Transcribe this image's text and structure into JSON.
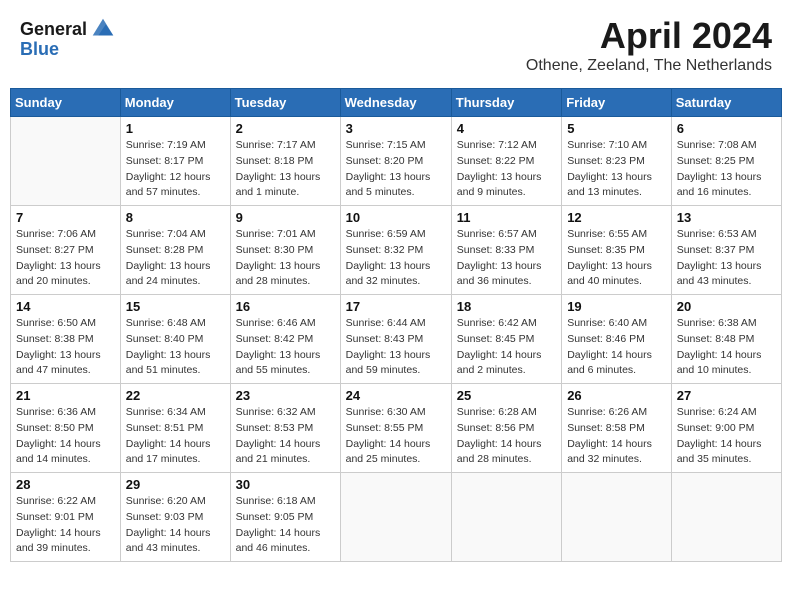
{
  "header": {
    "logo_general": "General",
    "logo_blue": "Blue",
    "month_title": "April 2024",
    "location": "Othene, Zeeland, The Netherlands"
  },
  "weekdays": [
    "Sunday",
    "Monday",
    "Tuesday",
    "Wednesday",
    "Thursday",
    "Friday",
    "Saturday"
  ],
  "weeks": [
    [
      {
        "day": "",
        "sunrise": "",
        "sunset": "",
        "daylight": "",
        "empty": true
      },
      {
        "day": "1",
        "sunrise": "Sunrise: 7:19 AM",
        "sunset": "Sunset: 8:17 PM",
        "daylight": "Daylight: 12 hours and 57 minutes."
      },
      {
        "day": "2",
        "sunrise": "Sunrise: 7:17 AM",
        "sunset": "Sunset: 8:18 PM",
        "daylight": "Daylight: 13 hours and 1 minute."
      },
      {
        "day": "3",
        "sunrise": "Sunrise: 7:15 AM",
        "sunset": "Sunset: 8:20 PM",
        "daylight": "Daylight: 13 hours and 5 minutes."
      },
      {
        "day": "4",
        "sunrise": "Sunrise: 7:12 AM",
        "sunset": "Sunset: 8:22 PM",
        "daylight": "Daylight: 13 hours and 9 minutes."
      },
      {
        "day": "5",
        "sunrise": "Sunrise: 7:10 AM",
        "sunset": "Sunset: 8:23 PM",
        "daylight": "Daylight: 13 hours and 13 minutes."
      },
      {
        "day": "6",
        "sunrise": "Sunrise: 7:08 AM",
        "sunset": "Sunset: 8:25 PM",
        "daylight": "Daylight: 13 hours and 16 minutes."
      }
    ],
    [
      {
        "day": "7",
        "sunrise": "Sunrise: 7:06 AM",
        "sunset": "Sunset: 8:27 PM",
        "daylight": "Daylight: 13 hours and 20 minutes."
      },
      {
        "day": "8",
        "sunrise": "Sunrise: 7:04 AM",
        "sunset": "Sunset: 8:28 PM",
        "daylight": "Daylight: 13 hours and 24 minutes."
      },
      {
        "day": "9",
        "sunrise": "Sunrise: 7:01 AM",
        "sunset": "Sunset: 8:30 PM",
        "daylight": "Daylight: 13 hours and 28 minutes."
      },
      {
        "day": "10",
        "sunrise": "Sunrise: 6:59 AM",
        "sunset": "Sunset: 8:32 PM",
        "daylight": "Daylight: 13 hours and 32 minutes."
      },
      {
        "day": "11",
        "sunrise": "Sunrise: 6:57 AM",
        "sunset": "Sunset: 8:33 PM",
        "daylight": "Daylight: 13 hours and 36 minutes."
      },
      {
        "day": "12",
        "sunrise": "Sunrise: 6:55 AM",
        "sunset": "Sunset: 8:35 PM",
        "daylight": "Daylight: 13 hours and 40 minutes."
      },
      {
        "day": "13",
        "sunrise": "Sunrise: 6:53 AM",
        "sunset": "Sunset: 8:37 PM",
        "daylight": "Daylight: 13 hours and 43 minutes."
      }
    ],
    [
      {
        "day": "14",
        "sunrise": "Sunrise: 6:50 AM",
        "sunset": "Sunset: 8:38 PM",
        "daylight": "Daylight: 13 hours and 47 minutes."
      },
      {
        "day": "15",
        "sunrise": "Sunrise: 6:48 AM",
        "sunset": "Sunset: 8:40 PM",
        "daylight": "Daylight: 13 hours and 51 minutes."
      },
      {
        "day": "16",
        "sunrise": "Sunrise: 6:46 AM",
        "sunset": "Sunset: 8:42 PM",
        "daylight": "Daylight: 13 hours and 55 minutes."
      },
      {
        "day": "17",
        "sunrise": "Sunrise: 6:44 AM",
        "sunset": "Sunset: 8:43 PM",
        "daylight": "Daylight: 13 hours and 59 minutes."
      },
      {
        "day": "18",
        "sunrise": "Sunrise: 6:42 AM",
        "sunset": "Sunset: 8:45 PM",
        "daylight": "Daylight: 14 hours and 2 minutes."
      },
      {
        "day": "19",
        "sunrise": "Sunrise: 6:40 AM",
        "sunset": "Sunset: 8:46 PM",
        "daylight": "Daylight: 14 hours and 6 minutes."
      },
      {
        "day": "20",
        "sunrise": "Sunrise: 6:38 AM",
        "sunset": "Sunset: 8:48 PM",
        "daylight": "Daylight: 14 hours and 10 minutes."
      }
    ],
    [
      {
        "day": "21",
        "sunrise": "Sunrise: 6:36 AM",
        "sunset": "Sunset: 8:50 PM",
        "daylight": "Daylight: 14 hours and 14 minutes."
      },
      {
        "day": "22",
        "sunrise": "Sunrise: 6:34 AM",
        "sunset": "Sunset: 8:51 PM",
        "daylight": "Daylight: 14 hours and 17 minutes."
      },
      {
        "day": "23",
        "sunrise": "Sunrise: 6:32 AM",
        "sunset": "Sunset: 8:53 PM",
        "daylight": "Daylight: 14 hours and 21 minutes."
      },
      {
        "day": "24",
        "sunrise": "Sunrise: 6:30 AM",
        "sunset": "Sunset: 8:55 PM",
        "daylight": "Daylight: 14 hours and 25 minutes."
      },
      {
        "day": "25",
        "sunrise": "Sunrise: 6:28 AM",
        "sunset": "Sunset: 8:56 PM",
        "daylight": "Daylight: 14 hours and 28 minutes."
      },
      {
        "day": "26",
        "sunrise": "Sunrise: 6:26 AM",
        "sunset": "Sunset: 8:58 PM",
        "daylight": "Daylight: 14 hours and 32 minutes."
      },
      {
        "day": "27",
        "sunrise": "Sunrise: 6:24 AM",
        "sunset": "Sunset: 9:00 PM",
        "daylight": "Daylight: 14 hours and 35 minutes."
      }
    ],
    [
      {
        "day": "28",
        "sunrise": "Sunrise: 6:22 AM",
        "sunset": "Sunset: 9:01 PM",
        "daylight": "Daylight: 14 hours and 39 minutes."
      },
      {
        "day": "29",
        "sunrise": "Sunrise: 6:20 AM",
        "sunset": "Sunset: 9:03 PM",
        "daylight": "Daylight: 14 hours and 43 minutes."
      },
      {
        "day": "30",
        "sunrise": "Sunrise: 6:18 AM",
        "sunset": "Sunset: 9:05 PM",
        "daylight": "Daylight: 14 hours and 46 minutes."
      },
      {
        "day": "",
        "sunrise": "",
        "sunset": "",
        "daylight": "",
        "empty": true
      },
      {
        "day": "",
        "sunrise": "",
        "sunset": "",
        "daylight": "",
        "empty": true
      },
      {
        "day": "",
        "sunrise": "",
        "sunset": "",
        "daylight": "",
        "empty": true
      },
      {
        "day": "",
        "sunrise": "",
        "sunset": "",
        "daylight": "",
        "empty": true
      }
    ]
  ]
}
